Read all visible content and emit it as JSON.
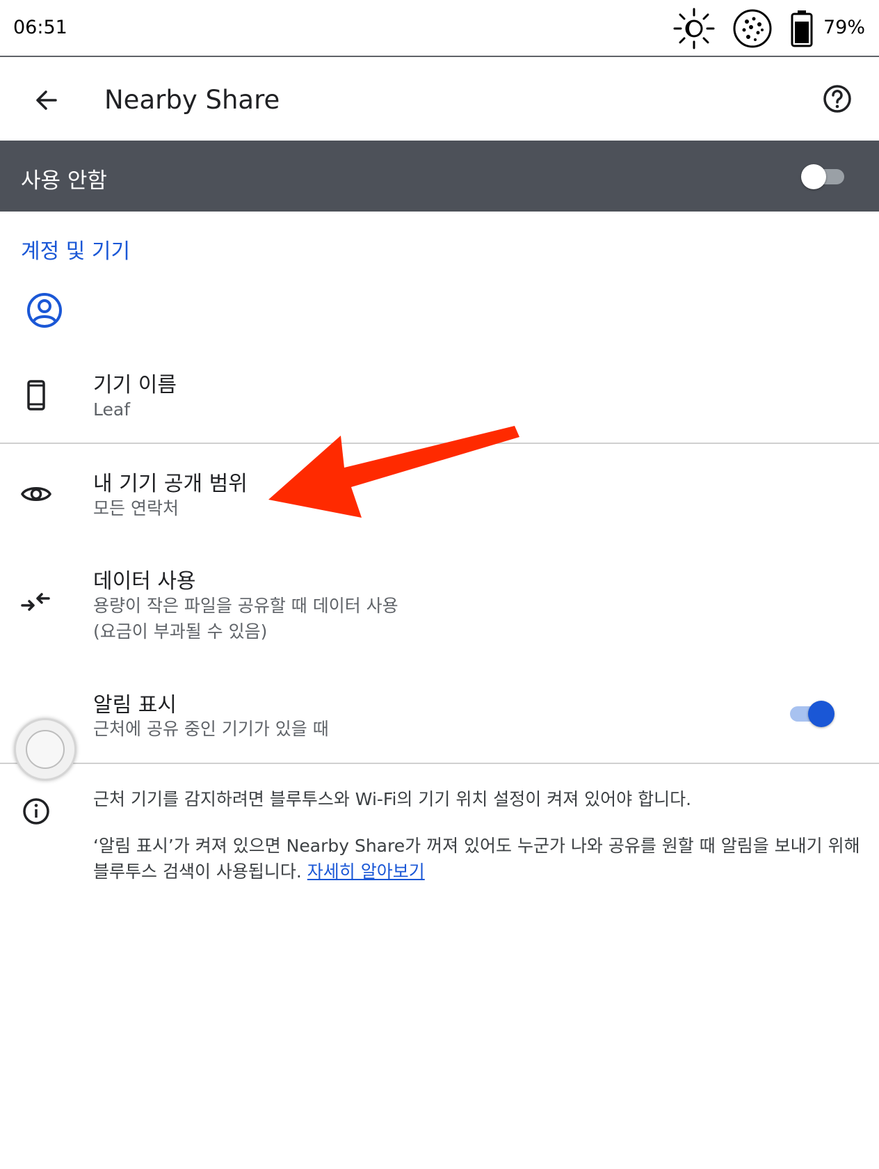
{
  "status_bar": {
    "time": "06:51",
    "battery_percent": "79%",
    "icons": [
      "brightness-icon",
      "reading-mode-icon",
      "battery-icon"
    ]
  },
  "app_bar": {
    "title": "Nearby Share",
    "back_icon": "arrow-left-icon",
    "help_icon": "help-circle-icon"
  },
  "master_toggle": {
    "label": "사용 안함",
    "enabled": false
  },
  "section": {
    "header": "계정 및 기기",
    "account_icon": "account-circle-icon"
  },
  "settings": [
    {
      "id": "device-name",
      "icon": "phone-icon",
      "title": "기기 이름",
      "subtitle": "Leaf"
    },
    {
      "id": "visibility",
      "icon": "eye-icon",
      "title": "내 기기 공개 범위",
      "subtitle": "모든 연락처"
    },
    {
      "id": "data-usage",
      "icon": "data-arrows-icon",
      "title": "데이터 사용",
      "subtitle_line1": "용량이 작은 파일을 공유할 때 데이터 사용",
      "subtitle_line2": "(요금이 부과될 수 있음)"
    },
    {
      "id": "notifications",
      "icon": "toggle-icon",
      "title": "알림 표시",
      "subtitle": "근처에 공유 중인 기기가 있을 때",
      "enabled": true
    }
  ],
  "info": {
    "icon": "info-icon",
    "line1": "근처 기기를 감지하려면 블루투스와 Wi-Fi의 기기 위치 설정이 켜져 있어야 합니다.",
    "line2": "‘알림 표시’가 켜져 있으면 Nearby Share가 꺼져 있어도 누군가 나와 공유를 원할 때 알림을 보내기 위해",
    "line3": "블루투스 검색이 사용됩니다.",
    "link": "자세히 알아보기"
  },
  "colors": {
    "accent": "#1a57d6",
    "master_bar": "#4d5159",
    "annotation_arrow": "#ff2a00"
  }
}
